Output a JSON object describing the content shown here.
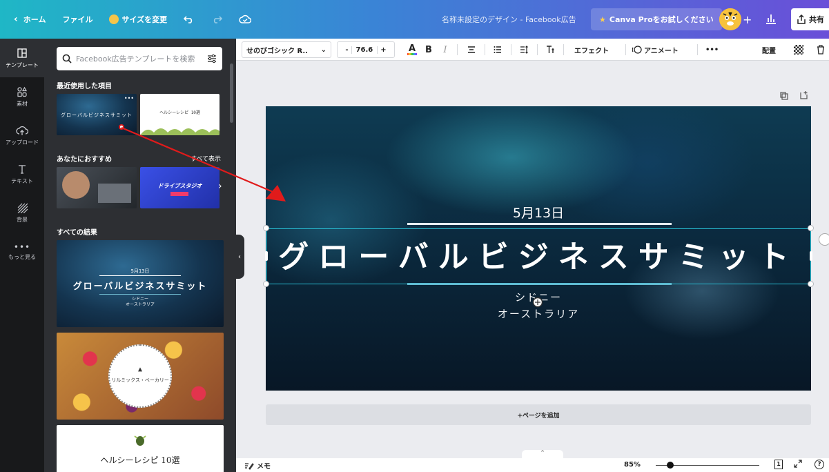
{
  "topbar": {
    "home_label": "ホーム",
    "file_label": "ファイル",
    "resize_label": "サイズを変更",
    "doc_title": "名称未設定のデザイン - Facebook広告",
    "pro_label": "Canva Proをお試しください",
    "plus": "+",
    "share_label": "共有"
  },
  "rail": {
    "templates": "テンプレート",
    "elements": "素材",
    "uploads": "アップロード",
    "text": "テキスト",
    "background": "背景",
    "more": "もっと見る"
  },
  "panel": {
    "search_placeholder": "Facebook広告テンプレートを検索",
    "recent_heading": "最近使用した項目",
    "recommended_heading": "あなたにおすすめ",
    "see_all": "すべて表示",
    "all_results_heading": "すべての結果",
    "thumb_recent_1": "グローバルビジネスサミット",
    "thumb_recent_2": "ヘルシーレシピ 10選",
    "thumb_drive": "ドライブスタジオ",
    "result_1_date": "5月13日",
    "result_1_title": "グローバルビジネスサミット",
    "result_1_city": "シドニー",
    "result_1_country": "オーストラリア",
    "result_2_title": "リルミックス・ベーカリー",
    "result_3_title": "ヘルシーレシピ 10選"
  },
  "toolbar": {
    "font_name": "せのびゴシック R..",
    "minus": "-",
    "font_size": "76.6",
    "plus": "+",
    "effects": "エフェクト",
    "animate": "アニメート",
    "more": "•••",
    "position": "配置"
  },
  "design": {
    "date": "5月13日",
    "title": "グローバルビジネスサミット",
    "city": "シドニー",
    "country": "オーストラリア"
  },
  "add_page_label": "+ページを追加",
  "bottombar": {
    "notes_label": "メモ",
    "zoom": "85%",
    "page_count": "1"
  },
  "colors": {
    "accent": "#28c0d6",
    "annotation_arrow": "#e01b1b"
  }
}
